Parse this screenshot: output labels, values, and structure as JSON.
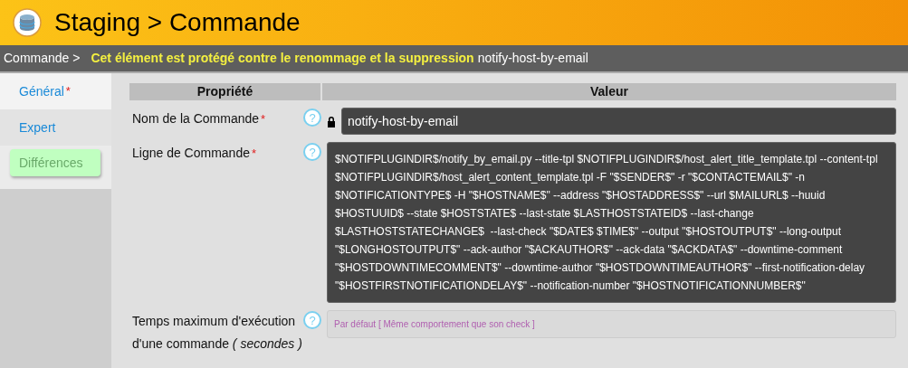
{
  "header": {
    "title": "Staging > Commande"
  },
  "breadcrumb": {
    "path": "Commande >",
    "notice": "Cet élément est protégé contre le renommage et la suppression",
    "item": "notify-host-by-email"
  },
  "tabs": [
    {
      "label": "Général",
      "required_mark": "*",
      "selected": true,
      "kind": "tab"
    },
    {
      "label": "Expert",
      "selected": false,
      "kind": "tab"
    },
    {
      "label": "Différences",
      "selected": false,
      "kind": "highlight"
    }
  ],
  "table": {
    "columns": [
      "Propriété",
      "Valeur"
    ],
    "rows": [
      {
        "kind": "locked",
        "label": "Nom de la Commande",
        "required_mark": "*",
        "help": "?",
        "value": "notify-host-by-email"
      },
      {
        "kind": "textarea",
        "label": "Ligne de Commande",
        "required_mark": "*",
        "help": "?",
        "lines": [
          "$NOTIFPLUGINDIR$/notify_by_email.py --title-tpl $NOTIFPLUGINDIR$/host_alert_title_template.tpl --content-tpl",
          "$NOTIFPLUGINDIR$/host_alert_content_template.tpl -F \"$SENDER$\" -r \"$CONTACTEMAIL$\" -n",
          "$NOTIFICATIONTYPE$ -H \"$HOSTNAME$\" --address \"$HOSTADDRESS$\" --url $MAILURL$ --huuid",
          "$HOSTUUID$ --state $HOSTSTATE$ --last-state $LASTHOSTSTATEID$ --last-change",
          "$LASTHOSTSTATECHANGE$  --last-check \"$DATE$ $TIME$\" --output \"$HOSTOUTPUT$\" --long-output",
          "\"$LONGHOSTOUTPUT$\" --ack-author \"$ACKAUTHOR$\" --ack-data \"$ACKDATA$\" --downtime-comment",
          "\"$HOSTDOWNTIMECOMMENT$\" --downtime-author \"$HOSTDOWNTIMEAUTHOR$\" --first-notification-delay",
          "\"$HOSTFIRSTNOTIFICATIONDELAY$\" --notification-number \"$HOSTNOTIFICATIONNUMBER$\""
        ]
      },
      {
        "kind": "default",
        "label": "Temps maximum d'exécution d'une commande *( secondes )*",
        "help": "?",
        "placeholder": "Par défaut [ Même comportement que son check ]"
      }
    ]
  }
}
